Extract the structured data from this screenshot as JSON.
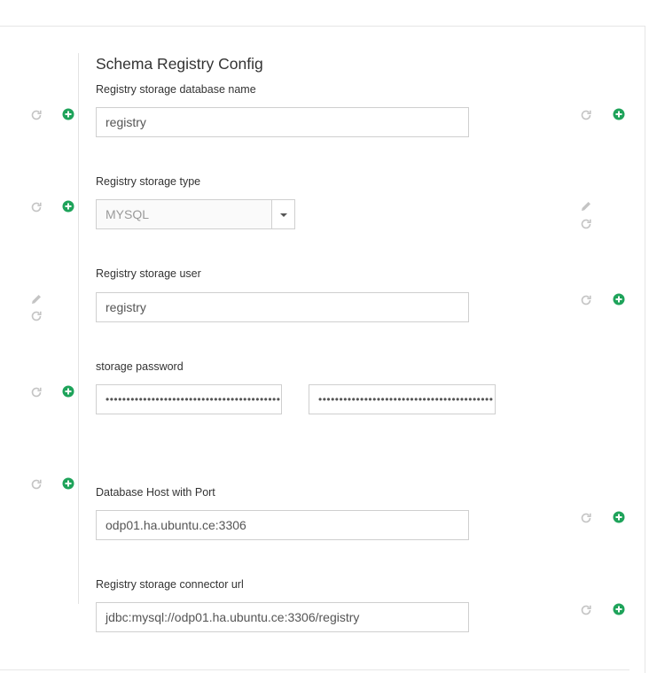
{
  "section": {
    "title": "Schema Registry Config"
  },
  "fields": [
    {
      "label": "Registry storage database name",
      "value": "registry"
    },
    {
      "label": "Registry storage type",
      "value": "MYSQL"
    },
    {
      "label": "Registry storage user",
      "value": "registry"
    },
    {
      "label": "storage password",
      "value": "••••••••••••••••••••••••••••••••••••••••••",
      "confirm_value": "••••••••••••••••••••••••••••••••••••••••••"
    },
    {
      "label": "Database Host with Port",
      "value": "odp01.ha.ubuntu.ce:3306"
    },
    {
      "label": "Registry storage connector url",
      "value": "jdbc:mysql://odp01.ha.ubuntu.ce:3306/registry"
    }
  ],
  "icons": {
    "undo": "undo-icon",
    "add": "plus-circle-icon",
    "edit": "pencil-icon"
  },
  "colors": {
    "add_green": "#1ea35a",
    "icon_grey": "#c4c4c4",
    "border": "#cfcfcf",
    "text": "#333333"
  }
}
